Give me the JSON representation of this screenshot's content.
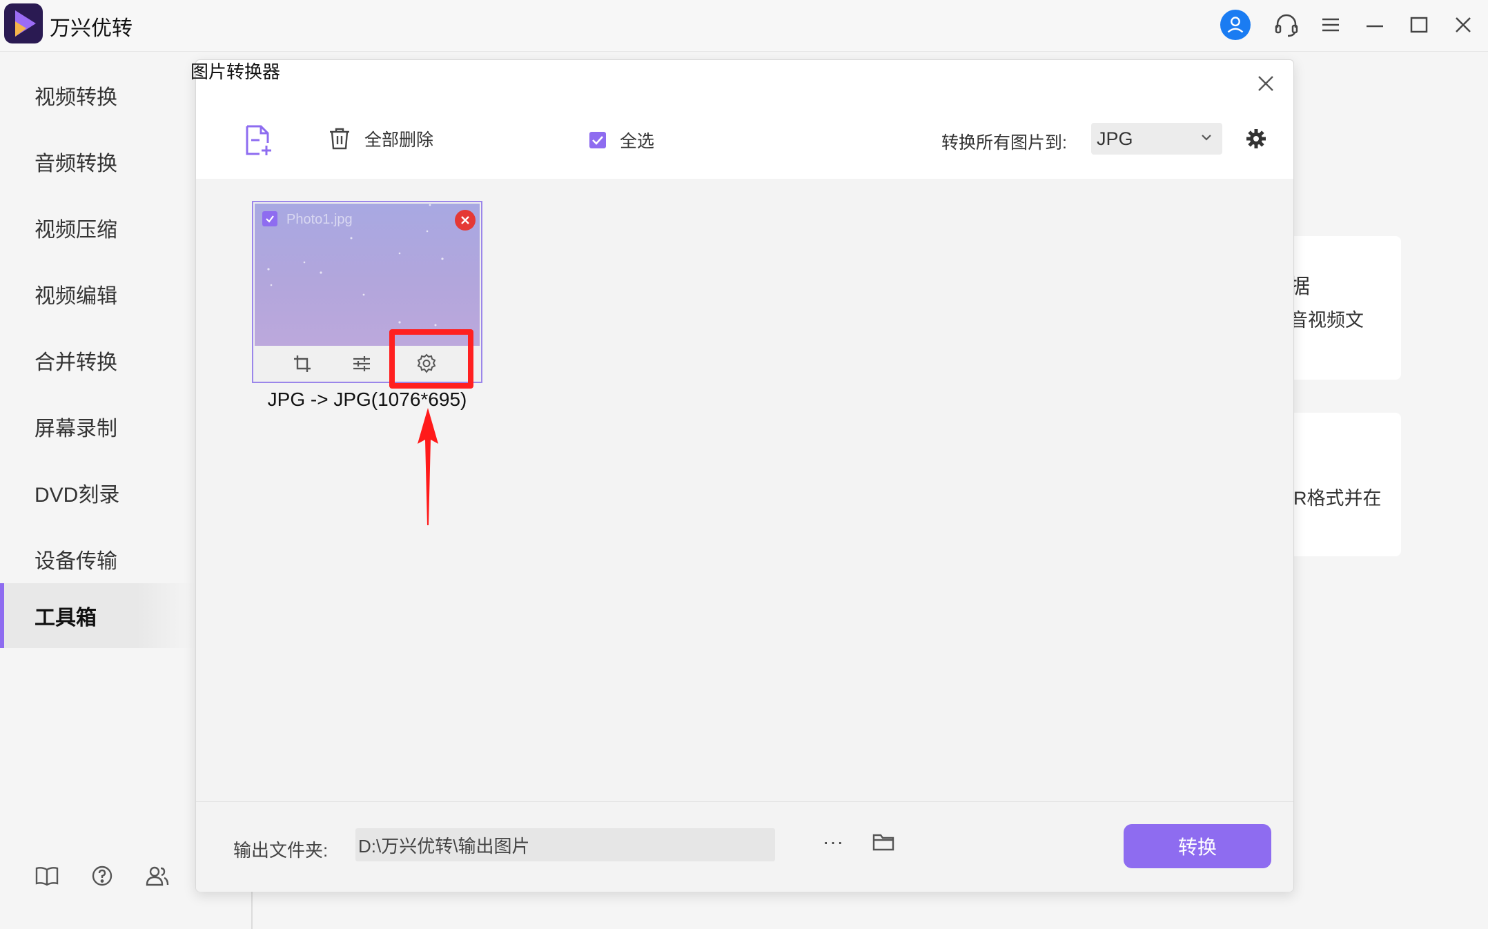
{
  "app": {
    "title": "万兴优转",
    "accent_color": "#8e6cf0",
    "logo_icon": "app-logo-play-icon"
  },
  "titlebar_icons": [
    "user-avatar-icon",
    "headset-support-icon",
    "menu-icon",
    "minimize-icon",
    "maximize-icon",
    "close-icon"
  ],
  "sidebar": {
    "items": [
      {
        "label": "视频转换",
        "active": false
      },
      {
        "label": "音频转换",
        "active": false
      },
      {
        "label": "视频压缩",
        "active": false
      },
      {
        "label": "视频编辑",
        "active": false
      },
      {
        "label": "合并转换",
        "active": false
      },
      {
        "label": "屏幕录制",
        "active": false
      },
      {
        "label": "DVD刻录",
        "active": false
      },
      {
        "label": "设备传输",
        "active": false
      },
      {
        "label": "工具箱",
        "active": true
      }
    ],
    "bottom_icons": [
      "book-icon",
      "help-icon",
      "users-icon"
    ]
  },
  "background": {
    "card1_line1": "据",
    "card1_line2": "音视频文",
    "card2_line1": "R格式并在"
  },
  "dialog": {
    "title": "图片转换器",
    "toolbar": {
      "delete_all_label": "全部删除",
      "select_all_label": "全选",
      "select_all_checked": true,
      "convert_to_label": "转换所有图片到:",
      "format_value": "JPG"
    },
    "thumbnail": {
      "file_name": "Photo1.jpg",
      "checked": true,
      "conversion_info": "JPG -> JPG(1076*695)",
      "tools": [
        "crop-icon",
        "adjust-icon",
        "settings-icon"
      ],
      "highlighted_tool": "settings-icon",
      "highlight_color": "#ff2020"
    },
    "footer": {
      "output_label": "输出文件夹:",
      "output_path": "D:\\万兴优转\\输出图片",
      "more_label": "···",
      "convert_label": "转换"
    }
  }
}
